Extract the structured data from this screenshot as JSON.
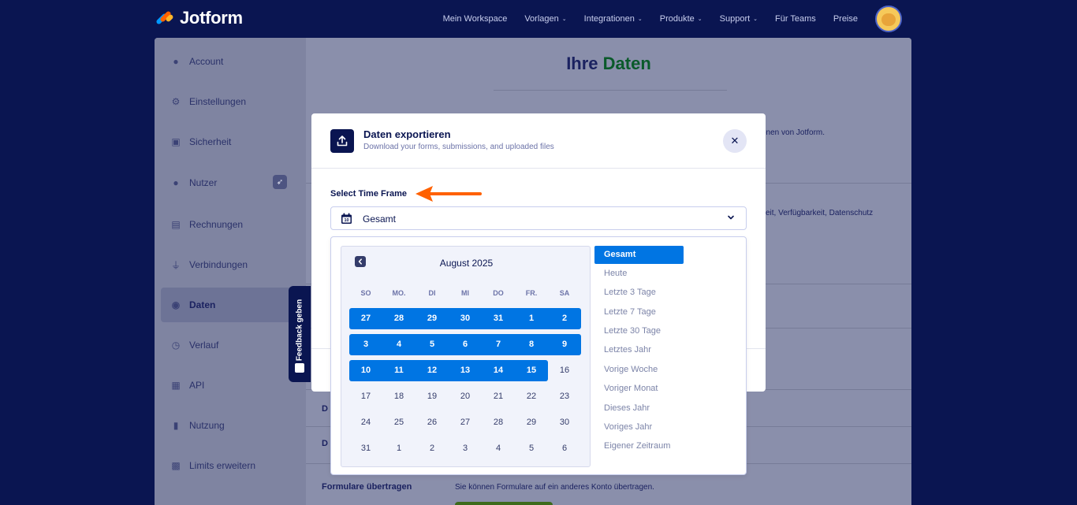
{
  "brand": {
    "name": "Jotform"
  },
  "nav": {
    "items": [
      {
        "label": "Mein Workspace",
        "has_dropdown": false
      },
      {
        "label": "Vorlagen",
        "has_dropdown": true
      },
      {
        "label": "Integrationen",
        "has_dropdown": true
      },
      {
        "label": "Produkte",
        "has_dropdown": true
      },
      {
        "label": "Support",
        "has_dropdown": true
      },
      {
        "label": "Für Teams",
        "has_dropdown": false
      },
      {
        "label": "Preise",
        "has_dropdown": false
      }
    ],
    "chevron": "⌄"
  },
  "sidebar": {
    "items": [
      {
        "label": "Account",
        "icon": "user-icon"
      },
      {
        "label": "Einstellungen",
        "icon": "gear-icon"
      },
      {
        "label": "Sicherheit",
        "icon": "lock-icon"
      },
      {
        "label": "Nutzer",
        "icon": "users-icon"
      },
      {
        "label": "Rechnungen",
        "icon": "invoice-icon"
      },
      {
        "label": "Verbindungen",
        "icon": "plug-icon"
      },
      {
        "label": "Daten",
        "icon": "database-icon",
        "active": true
      },
      {
        "label": "Verlauf",
        "icon": "history-icon"
      },
      {
        "label": "API",
        "icon": "api-icon"
      },
      {
        "label": "Nutzung",
        "icon": "bar-chart-icon"
      },
      {
        "label": "Limits erweitern",
        "icon": "gift-icon"
      }
    ]
  },
  "main": {
    "title_prefix": "Ihre",
    "title_highlight": "Daten",
    "snippet_1": "onen von Jotform.",
    "snippet_2": "keit, Verfügbarkeit, Datenschutz",
    "row_d1": "D",
    "row_d2": "D",
    "transfer_label": "Formulare übertragen",
    "transfer_desc": "Sie können Formulare auf ein anderes Konto übertragen."
  },
  "feedback": {
    "label": "Feedback geben"
  },
  "modal": {
    "title": "Daten exportieren",
    "subtitle": "Download your forms, submissions, and uploaded files",
    "close": "✕",
    "time_frame_label": "Select Time Frame",
    "select_value": "Gesamt",
    "calendar_icon_day": "10"
  },
  "calendar": {
    "month": "August 2025",
    "weekdays": [
      "SO",
      "MO.",
      "DI",
      "MI",
      "DO",
      "FR.",
      "SA"
    ],
    "weeks": [
      [
        "27",
        "28",
        "29",
        "30",
        "31",
        "1",
        "2"
      ],
      [
        "3",
        "4",
        "5",
        "6",
        "7",
        "8",
        "9"
      ],
      [
        "10",
        "11",
        "12",
        "13",
        "14",
        "15",
        "16"
      ],
      [
        "17",
        "18",
        "19",
        "20",
        "21",
        "22",
        "23"
      ],
      [
        "24",
        "25",
        "26",
        "27",
        "28",
        "29",
        "30"
      ],
      [
        "31",
        "1",
        "2",
        "3",
        "4",
        "5",
        "6"
      ]
    ],
    "selected_through": {
      "week": 2,
      "day": 5
    }
  },
  "range_options": [
    {
      "label": "Gesamt",
      "active": true
    },
    {
      "label": "Heute"
    },
    {
      "label": "Letzte 3 Tage"
    },
    {
      "label": "Letzte 7 Tage"
    },
    {
      "label": "Letzte 30 Tage"
    },
    {
      "label": "Letztes Jahr"
    },
    {
      "label": "Vorige Woche"
    },
    {
      "label": "Voriger Monat"
    },
    {
      "label": "Dieses Jahr"
    },
    {
      "label": "Voriges Jahr"
    },
    {
      "label": "Eigener Zeitraum"
    }
  ],
  "colors": {
    "navy": "#0a1551",
    "accent_blue": "#0075e3",
    "annotation_arrow": "#ff6100",
    "logo_orange": "#ff6100",
    "logo_blue": "#0099ff",
    "logo_yellow": "#ffb629"
  }
}
